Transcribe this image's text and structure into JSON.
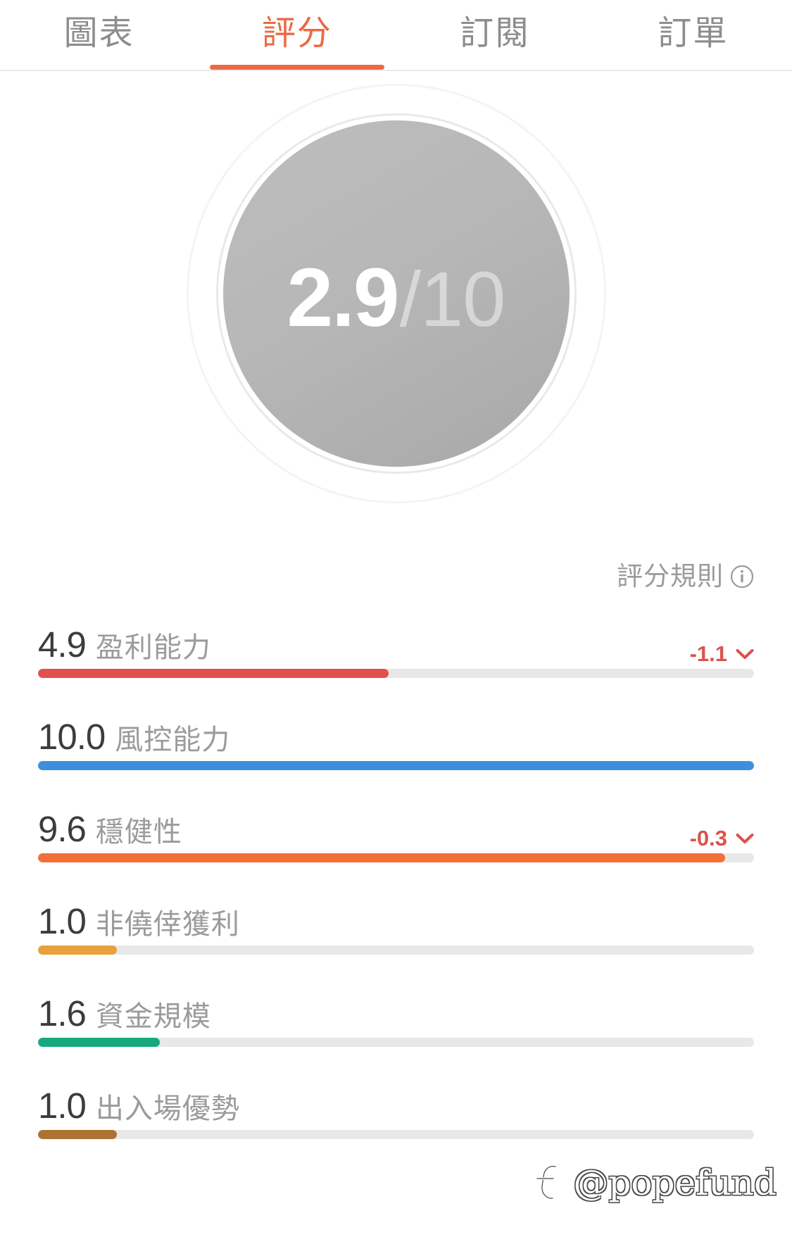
{
  "tabs": [
    {
      "label": "圖表",
      "active": false
    },
    {
      "label": "評分",
      "active": true
    },
    {
      "label": "訂閱",
      "active": false
    },
    {
      "label": "訂單",
      "active": false
    }
  ],
  "gauge": {
    "score": "2.9",
    "total": "/10",
    "score_value": 2.9,
    "max_value": 10
  },
  "rules": {
    "label": "評分規則",
    "icon": "info-circle-icon"
  },
  "metrics": [
    {
      "value": "4.9",
      "name": "盈利能力",
      "delta": "-1.1",
      "has_delta": true,
      "fill_pct": 49,
      "color": "#e1504e"
    },
    {
      "value": "10.0",
      "name": "風控能力",
      "delta": "",
      "has_delta": false,
      "fill_pct": 100,
      "color": "#3d8fdd"
    },
    {
      "value": "9.6",
      "name": "穩健性",
      "delta": "-0.3",
      "has_delta": true,
      "fill_pct": 96,
      "color": "#f4703a"
    },
    {
      "value": "1.0",
      "name": "非僥倖獲利",
      "delta": "",
      "has_delta": false,
      "fill_pct": 11,
      "color": "#e8a13c"
    },
    {
      "value": "1.6",
      "name": "資金規模",
      "delta": "",
      "has_delta": false,
      "fill_pct": 17,
      "color": "#16a97f"
    },
    {
      "value": "1.0",
      "name": "出入場優勢",
      "delta": "",
      "has_delta": false,
      "fill_pct": 11,
      "color": "#ab7332"
    }
  ],
  "watermark": {
    "handle": "@popefund",
    "logo": "popefund-logo-icon"
  },
  "colors": {
    "accent": "#eb6a43",
    "negative": "#d9534f",
    "track": "#e8e8e8",
    "muted_text": "#9b9b9b",
    "value_text": "#3c3c3c"
  },
  "chart_data": {
    "type": "bar",
    "title": "評分",
    "categories": [
      "盈利能力",
      "風控能力",
      "穩健性",
      "非僥倖獲利",
      "資金規模",
      "出入場優勢"
    ],
    "values": [
      4.9,
      10.0,
      9.6,
      1.0,
      1.6,
      1.0
    ],
    "deltas": [
      -1.1,
      null,
      -0.3,
      null,
      null,
      null
    ],
    "bar_colors": [
      "#e1504e",
      "#3d8fdd",
      "#f4703a",
      "#e8a13c",
      "#16a97f",
      "#ab7332"
    ],
    "overall_score": 2.9,
    "xlabel": "",
    "ylabel": "",
    "ylim": [
      0,
      10
    ],
    "grid": false,
    "legend": "none",
    "orientation": "horizontal"
  }
}
